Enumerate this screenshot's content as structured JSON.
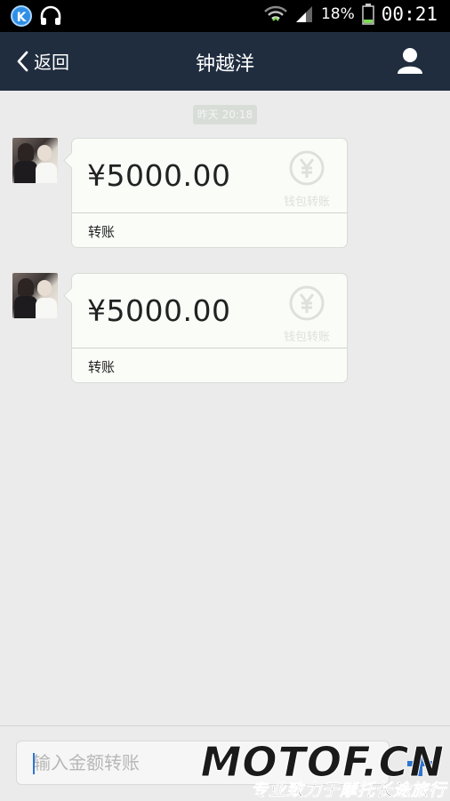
{
  "status_bar": {
    "battery": "18%",
    "time": "00:21"
  },
  "nav": {
    "back_label": "返回",
    "title": "钟越洋"
  },
  "chat": {
    "timestamp": "昨天 20:18",
    "messages": [
      {
        "amount": "¥5000.00",
        "watermark_label": "钱包转账",
        "caption": "转账"
      },
      {
        "amount": "¥5000.00",
        "watermark_label": "钱包转账",
        "caption": "转账"
      }
    ]
  },
  "input": {
    "placeholder": "输入金额转账"
  },
  "watermark": {
    "brand": "MOTOF.CN",
    "slogan": "专业致力于摩托长途旅行"
  },
  "colors": {
    "nav_bg": "#202d3f",
    "background": "#ebebeb",
    "card_bg": "#fafcf8"
  }
}
